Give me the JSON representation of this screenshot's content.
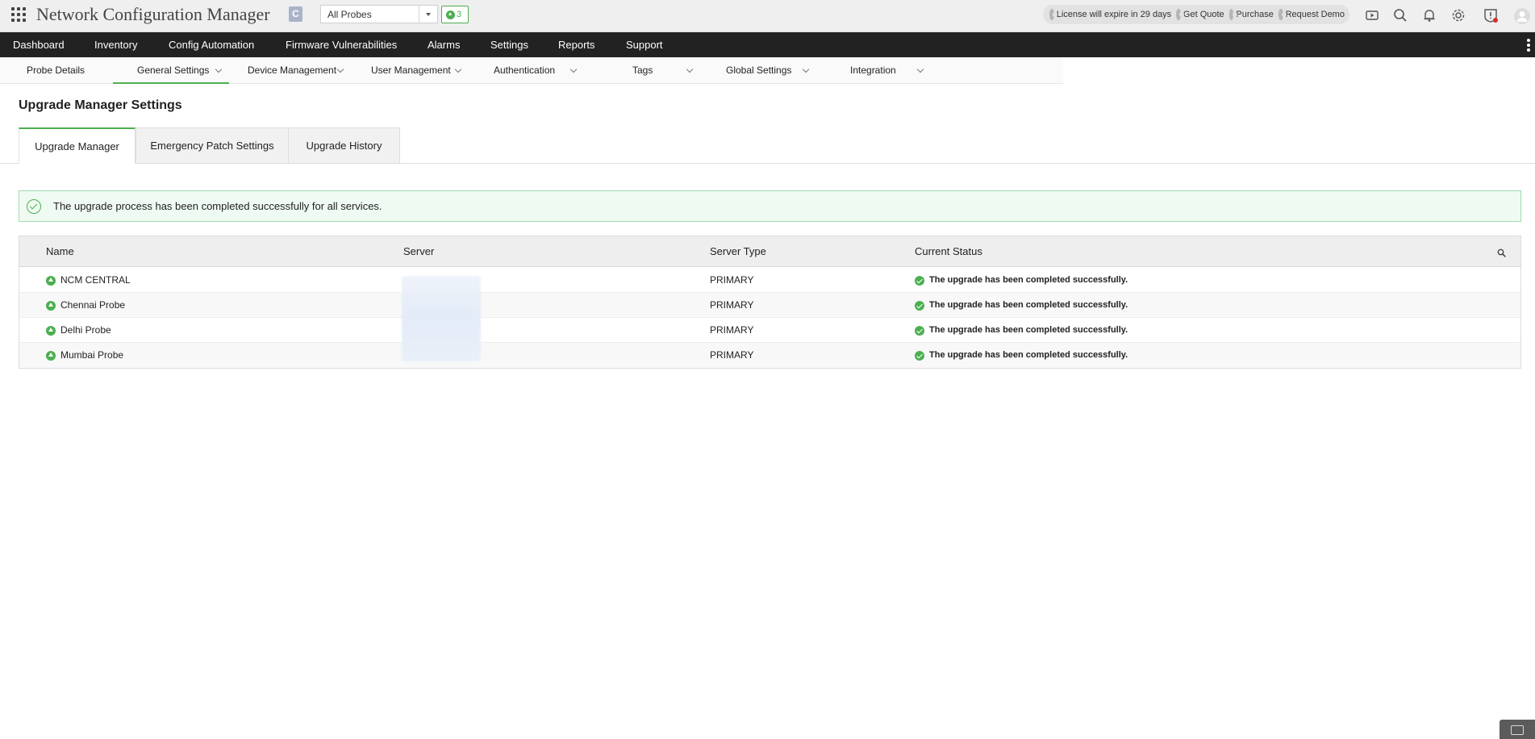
{
  "header": {
    "app_title": "Network Configuration Manager",
    "edition_badge": "C",
    "probe_select": "All Probes",
    "upgrade_count": "3",
    "license_text": "License will expire in 29 days",
    "get_quote": "Get Quote",
    "purchase": "Purchase",
    "request_demo": "Request Demo"
  },
  "main_nav": [
    "Dashboard",
    "Inventory",
    "Config Automation",
    "Firmware Vulnerabilities",
    "Alarms",
    "Settings",
    "Reports",
    "Support"
  ],
  "sub_nav": [
    "Probe Details",
    "General Settings",
    "Device Management",
    "User Management",
    "Authentication",
    "Tags",
    "Global Settings",
    "Integration"
  ],
  "page": {
    "title": "Upgrade Manager Settings",
    "tabs": [
      "Upgrade Manager",
      "Emergency Patch Settings",
      "Upgrade History"
    ],
    "alert": "The upgrade process has been completed successfully for all services."
  },
  "grid": {
    "columns": [
      "Name",
      "Server",
      "Server Type",
      "Current Status"
    ],
    "rows": [
      {
        "name": "NCM CENTRAL",
        "server_type": "PRIMARY",
        "status": "The upgrade has been completed successfully."
      },
      {
        "name": "Chennai Probe",
        "server_type": "PRIMARY",
        "status": "The upgrade has been completed successfully."
      },
      {
        "name": "Delhi Probe",
        "server_type": "PRIMARY",
        "status": "The upgrade has been completed successfully."
      },
      {
        "name": "Mumbai Probe",
        "server_type": "PRIMARY",
        "status": "The upgrade has been completed successfully."
      }
    ]
  },
  "colors": {
    "accent_green": "#4caf50",
    "nav_bg": "#222222",
    "alert_bg": "#effbf2"
  }
}
